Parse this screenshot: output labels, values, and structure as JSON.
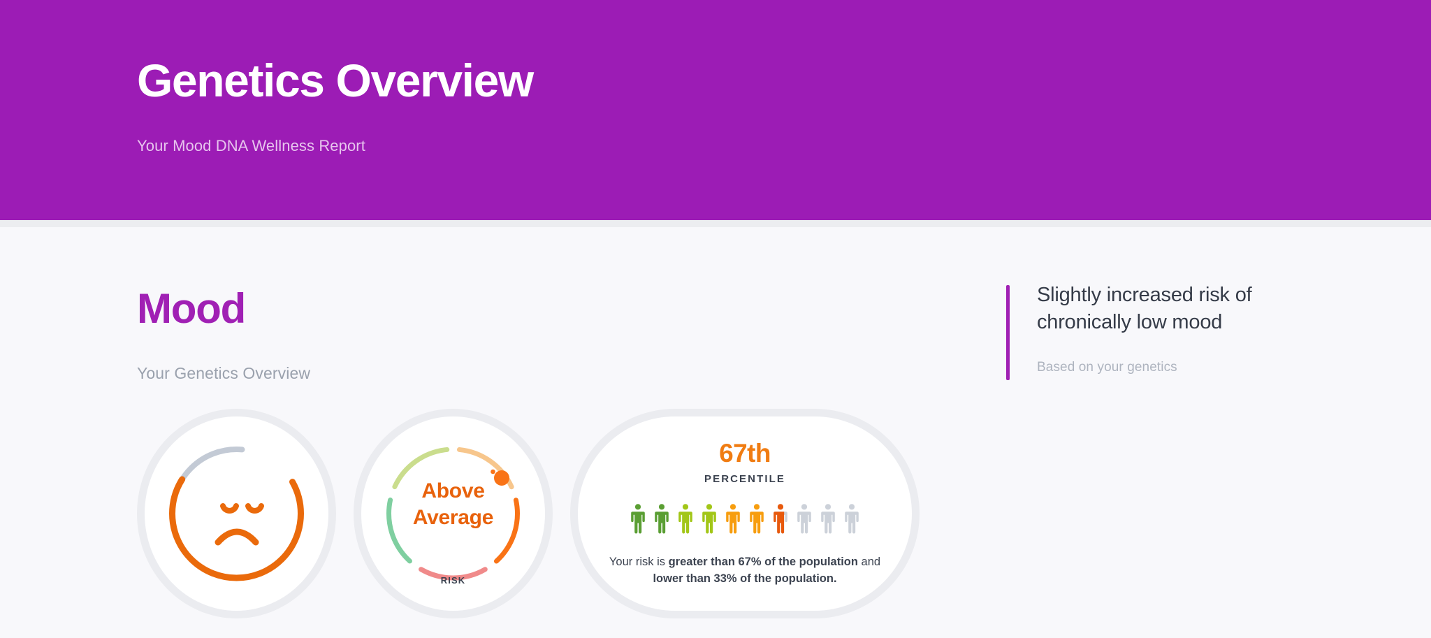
{
  "header": {
    "title": "Genetics Overview",
    "subtitle": "Your Mood DNA Wellness Report",
    "background_color": "#9c1cb5"
  },
  "section": {
    "title": "Mood",
    "subtitle": "Your Genetics Overview",
    "title_color": "#a020b4"
  },
  "callout": {
    "title": "Slightly increased risk of chronically low mood",
    "subtitle": "Based on your genetics",
    "accent_color": "#a020b4"
  },
  "face_widget": {
    "mood": "sad",
    "progress_percent": 67,
    "arc_color": "#ea6a0b",
    "track_color": "#c3cad5"
  },
  "gauge_widget": {
    "value_label": "Above Average",
    "value_line_1": "Above",
    "value_line_2": "Average",
    "caption": "RISK",
    "value_color": "#e8620c",
    "marker_color": "#f97316",
    "segments": [
      {
        "name": "low",
        "color": "#7fcfa0"
      },
      {
        "name": "below-average",
        "color": "#cadd8d"
      },
      {
        "name": "average",
        "color": "#f7c68c"
      },
      {
        "name": "above-average",
        "color": "#f97316"
      },
      {
        "name": "high",
        "color": "#f08a8a"
      }
    ]
  },
  "percentile_card": {
    "value": "67th",
    "unit": "PERCENTILE",
    "footnote_prefix": "Your risk is ",
    "footnote_bold_1": "greater than 67% of the population",
    "footnote_middle": " and ",
    "footnote_bold_2": "lower than 33% of the population.",
    "value_color": "#f07c12"
  },
  "chart_data": {
    "type": "pictogram",
    "title": "67th PERCENTILE",
    "total_figures": 10,
    "filled_figures": 6.7,
    "percentile": 67,
    "categories": [
      "1",
      "2",
      "3",
      "4",
      "5",
      "6",
      "7",
      "8",
      "9",
      "10"
    ],
    "values": [
      100,
      100,
      100,
      100,
      100,
      100,
      70,
      0,
      0,
      0
    ],
    "figure_colors": [
      "#5a9e33",
      "#5a9e33",
      "#a2c617",
      "#a2c617",
      "#f79d0e",
      "#f79d0e",
      "#e8590c",
      "#ccd1d9",
      "#ccd1d9",
      "#ccd1d9"
    ],
    "empty_color": "#ccd1d9",
    "legend": [
      "greater than 67% of the population",
      "lower than 33% of the population"
    ]
  }
}
